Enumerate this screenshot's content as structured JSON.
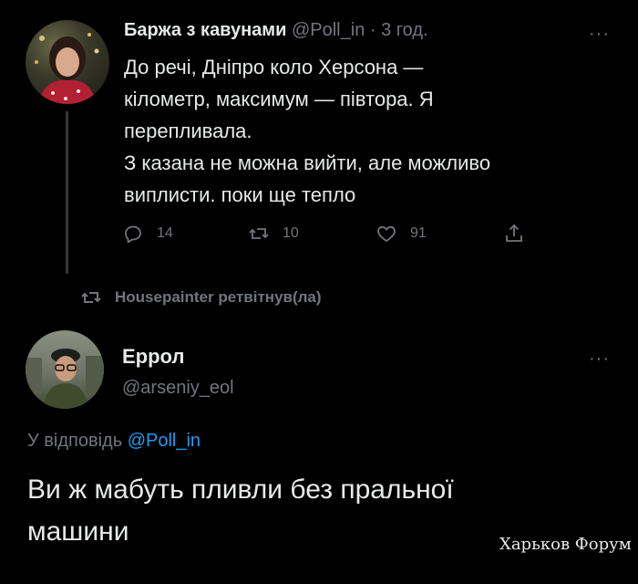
{
  "tweet1": {
    "author_name": "Баржа з кавунами",
    "handle": "@Poll_in",
    "separator": "·",
    "time": "3 год.",
    "lines": [
      "До речі, Дніпро коло Херсона —",
      "кілометр, максимум — півтора. Я",
      "перепливала.",
      "З казана не можна вийти, але можливо",
      "виплисти. поки ще тепло"
    ],
    "replies": "14",
    "retweets": "10",
    "likes": "91",
    "more": "···"
  },
  "retweet_banner": {
    "text": "Housepainter ретвітнув(ла)"
  },
  "tweet2": {
    "author_name": "Еррол",
    "handle": "@arseniy_eol",
    "more": "···",
    "reply_prefix": "У відповідь",
    "reply_to": "@Poll_in",
    "lines": [
      "Ви ж мабуть пливли без пральної",
      "машини"
    ]
  },
  "watermark": "Харьков Форум",
  "icons": {
    "reply": "reply-icon",
    "retweet": "retweet-icon",
    "like": "heart-icon",
    "share": "share-icon"
  },
  "colors": {
    "background": "#000000",
    "text": "#e7e9ea",
    "muted": "#71767b",
    "link": "#1d9bf0"
  }
}
